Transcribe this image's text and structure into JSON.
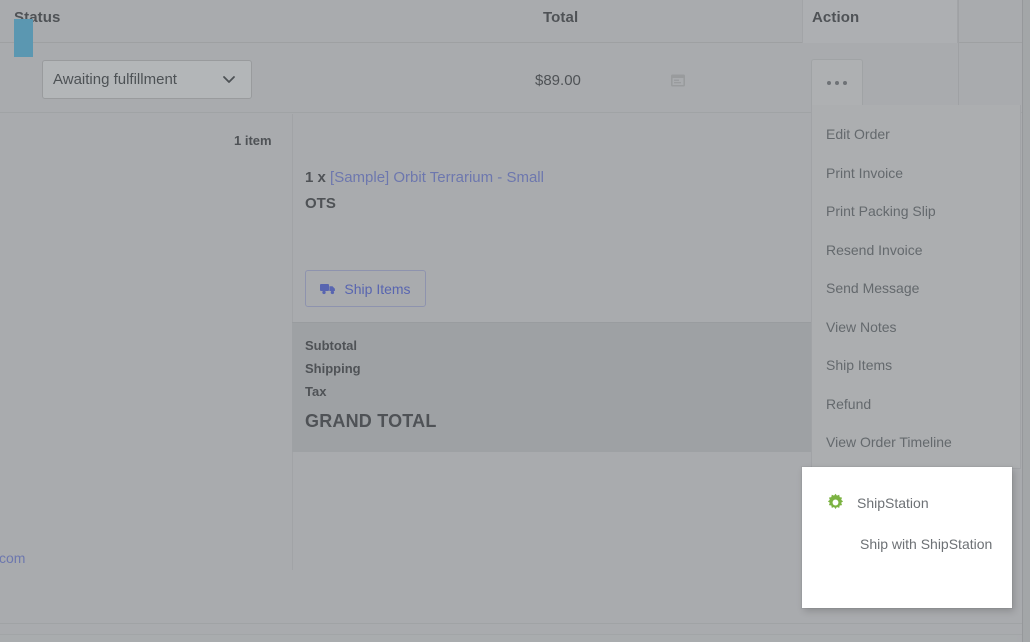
{
  "table": {
    "headers": {
      "status": "Status",
      "total": "Total",
      "action": "Action"
    }
  },
  "order": {
    "status_value": "Awaiting fulfillment",
    "status_options": [
      "Awaiting fulfillment"
    ],
    "total": "$89.00",
    "calendar_icon": "calendar-icon",
    "status_color": "#51a5c9"
  },
  "detail": {
    "item_count": "1 item",
    "line_item": {
      "quantity": "1 x",
      "product_name": "[Sample] Orbit Terrarium - Small",
      "sku": "OTS"
    },
    "ship_items_button": {
      "label": "Ship Items",
      "icon": "truck-icon",
      "color": "#4d5ec7"
    },
    "totals": {
      "subtotal_label": "Subtotal",
      "shipping_label": "Shipping",
      "tax_label": "Tax",
      "grand_total_label": "GRAND TOTAL"
    },
    "email_fragment": "com"
  },
  "action_menu": {
    "trigger_icon": "ellipsis-icon",
    "items": [
      {
        "label": "Edit Order"
      },
      {
        "label": "Print Invoice"
      },
      {
        "label": "Print Packing Slip"
      },
      {
        "label": "Resend Invoice"
      },
      {
        "label": "Send Message"
      },
      {
        "label": "View Notes"
      },
      {
        "label": "Ship Items"
      },
      {
        "label": "Refund"
      },
      {
        "label": "View Order Timeline"
      }
    ],
    "shipstation": {
      "group_title": "ShipStation",
      "icon": "gear-icon",
      "icon_color": "#7cb342",
      "action_label": "Ship with ShipStation"
    }
  }
}
